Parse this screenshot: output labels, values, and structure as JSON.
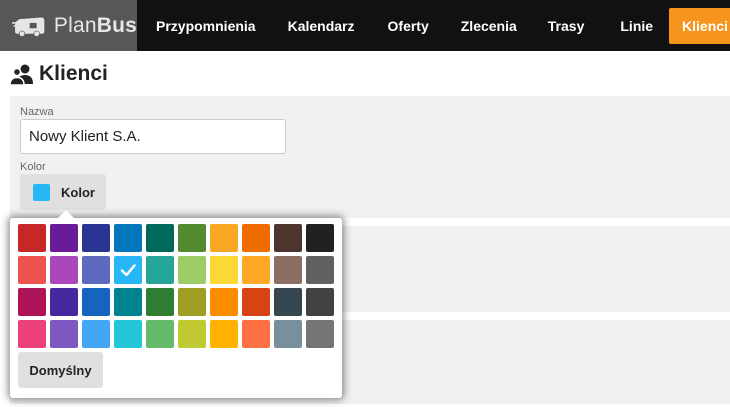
{
  "brand": {
    "plan": "Plan",
    "bus": "Bus"
  },
  "nav": [
    {
      "label": "Przypomnienia",
      "active": false
    },
    {
      "label": "Kalendarz",
      "active": false
    },
    {
      "label": "Oferty",
      "active": false
    },
    {
      "label": "Zlecenia",
      "active": false
    },
    {
      "label": "Trasy",
      "active": false
    },
    {
      "label": "Linie",
      "active": false
    },
    {
      "label": "Klienci",
      "active": true
    }
  ],
  "page": {
    "title": "Klienci",
    "icon": "users-icon"
  },
  "form": {
    "name_label": "Nazwa",
    "name_value": "Nowy Klient S.A.",
    "color_label": "Kolor",
    "color_button_label": "Kolor",
    "selected_color": "#29b6f6"
  },
  "palette": {
    "colors": [
      [
        "#c62828",
        "#6a1b9a",
        "#283593",
        "#0277bd",
        "#00695c",
        "#558b2f",
        "#f9a825",
        "#ef6c00",
        "#4e342e",
        "#212121"
      ],
      [
        "#ef5350",
        "#ab47bc",
        "#5c6bc0",
        "#29b6f6",
        "#26a69a",
        "#9ccc65",
        "#fdd835",
        "#ffa726",
        "#8d6e63",
        "#616161"
      ],
      [
        "#ad1457",
        "#4527a0",
        "#1565c0",
        "#00838f",
        "#2e7d32",
        "#9e9d24",
        "#fb8c00",
        "#d84315",
        "#37474f",
        "#424242"
      ],
      [
        "#ec407a",
        "#7e57c2",
        "#42a5f5",
        "#26c6da",
        "#66bb6a",
        "#c0ca33",
        "#ffb300",
        "#ff7043",
        "#78909c",
        "#757575"
      ]
    ],
    "selected": "#29b6f6",
    "check_icon": "check-icon",
    "default_label": "Domyślny"
  }
}
